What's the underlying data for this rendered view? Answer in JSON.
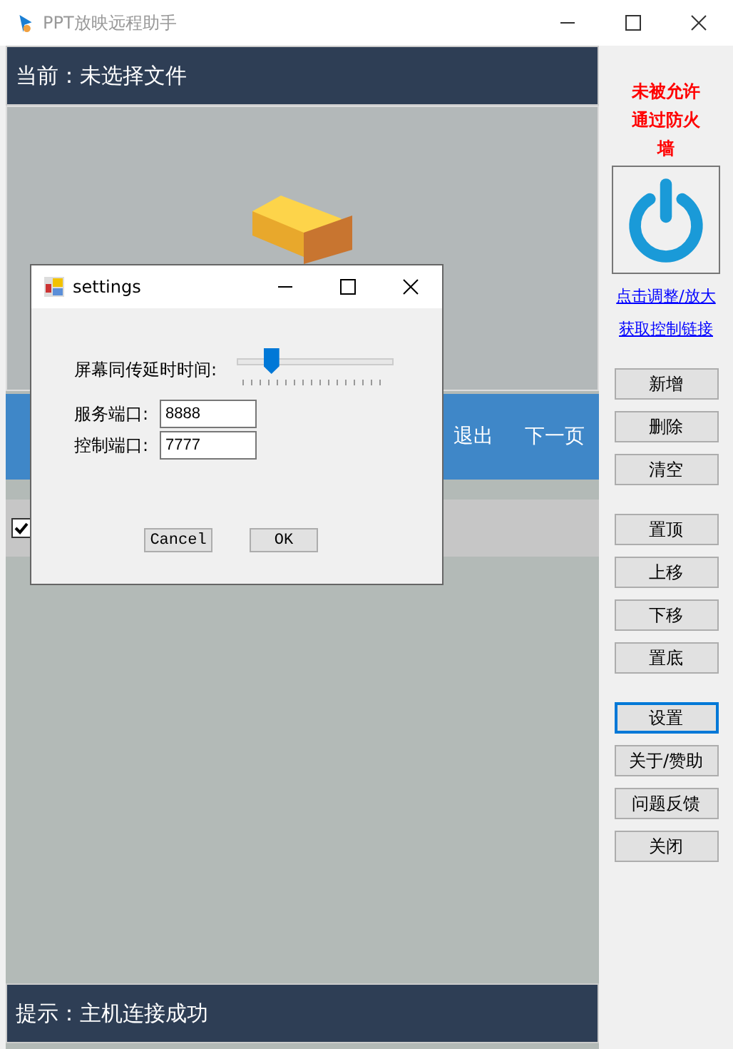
{
  "window": {
    "title": "PPT放映远程助手"
  },
  "current_file": "当前：未选择文件",
  "control_bar": {
    "buttons": [
      "退出",
      "下一页"
    ]
  },
  "file_list": [
    {
      "checked": true
    }
  ],
  "status": "提示：主机连接成功",
  "sidebar": {
    "firewall_warning": "未被允许通过防火墙",
    "links": [
      "点击调整/放大",
      "获取控制链接"
    ],
    "button_groups": [
      [
        {
          "label": "新增",
          "focused": false
        },
        {
          "label": "删除",
          "focused": false
        },
        {
          "label": "清空",
          "focused": false
        }
      ],
      [
        {
          "label": "置顶",
          "focused": false
        },
        {
          "label": "上移",
          "focused": false
        },
        {
          "label": "下移",
          "focused": false
        },
        {
          "label": "置底",
          "focused": false
        }
      ],
      [
        {
          "label": "设置",
          "focused": true
        },
        {
          "label": "关于/赞助",
          "focused": false
        },
        {
          "label": "问题反馈",
          "focused": false
        },
        {
          "label": "关闭",
          "focused": false
        }
      ]
    ]
  },
  "dialog": {
    "title": "settings",
    "delay_label": "屏幕同传延时时间:",
    "delay": {
      "level": 0.18
    },
    "fields": [
      {
        "label": "服务端口:",
        "value": "8888"
      },
      {
        "label": "控制端口:",
        "value": "7777"
      }
    ],
    "buttons": [
      "Cancel",
      "OK"
    ]
  }
}
